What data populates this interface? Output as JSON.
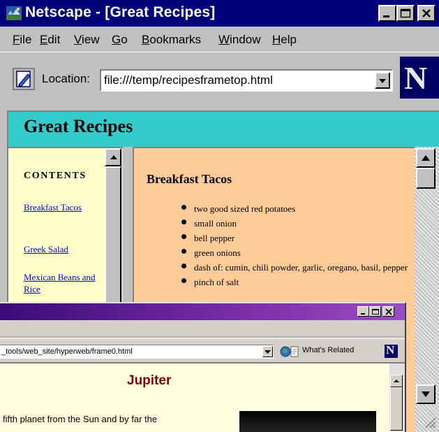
{
  "netscape_window": {
    "title": "Netscape - [Great Recipes]",
    "menu": [
      {
        "key": "F",
        "rest": "ile"
      },
      {
        "key": "E",
        "rest": "dit"
      },
      {
        "key": "V",
        "rest": "iew"
      },
      {
        "key": "G",
        "rest": "o"
      },
      {
        "key": "B",
        "rest": "ookmarks"
      },
      {
        "key": "W",
        "rest": "indow"
      },
      {
        "key": "H",
        "rest": "elp"
      }
    ],
    "location_label": "Location:",
    "location_value": "file:///temp/recipesframetop.html",
    "logo_letter": "N",
    "top_frame_heading": "Great Recipes",
    "contents_heading": "CONTENTS",
    "contents_links": [
      "Breakfast Tacos",
      "Greek Salad",
      "Mexican Beans and Rice"
    ],
    "recipe_title": "Breakfast Tacos",
    "ingredients": [
      "two good sized red potatoes",
      "small onion",
      "bell pepper",
      "green onions",
      "dash of: cumin, chili powder, garlic, oregano, basil, pepper",
      "pinch of salt"
    ],
    "colors": {
      "titlebar": "#00007b",
      "top_frame": "#33cccc",
      "left_frame": "#ffffcc",
      "main_frame": "#ffcc99"
    }
  },
  "browser_window": {
    "location_value": "_tools/web_site/hyperweb/frame0.html",
    "related_label": "What's Related",
    "logo_letter": "N",
    "page_title": "Jupiter",
    "body_text": "fifth planet from the Sun and by far the",
    "colors": {
      "title_accent": "#800000",
      "page_background": "#ffffe0"
    }
  }
}
